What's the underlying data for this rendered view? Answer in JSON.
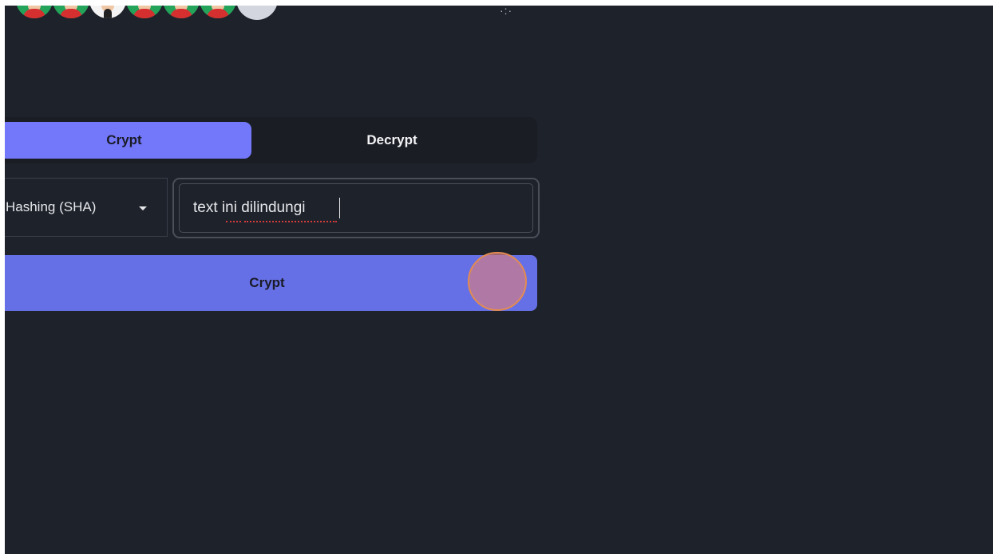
{
  "header": {
    "avatars": [
      "avatar-user",
      "avatar-user",
      "avatar-user",
      "avatar-user",
      "avatar-user",
      "avatar-user",
      "avatar-user",
      "avatar-more"
    ],
    "overflow_icon": "dots-icon"
  },
  "tabs": {
    "items": [
      {
        "label": "Crypt",
        "active": true
      },
      {
        "label": "Decrypt",
        "active": false
      }
    ]
  },
  "form": {
    "method": {
      "selected": "Hashing (SHA)",
      "icon": "chevron-down-icon"
    },
    "text": {
      "value": "text ini dilindungi",
      "placeholder": ""
    }
  },
  "actions": {
    "crypt_label": "Crypt"
  },
  "colors": {
    "background": "#1e222b",
    "accent": "#7378fb",
    "button": "#6670e6",
    "click_marker": "#e38b52"
  }
}
